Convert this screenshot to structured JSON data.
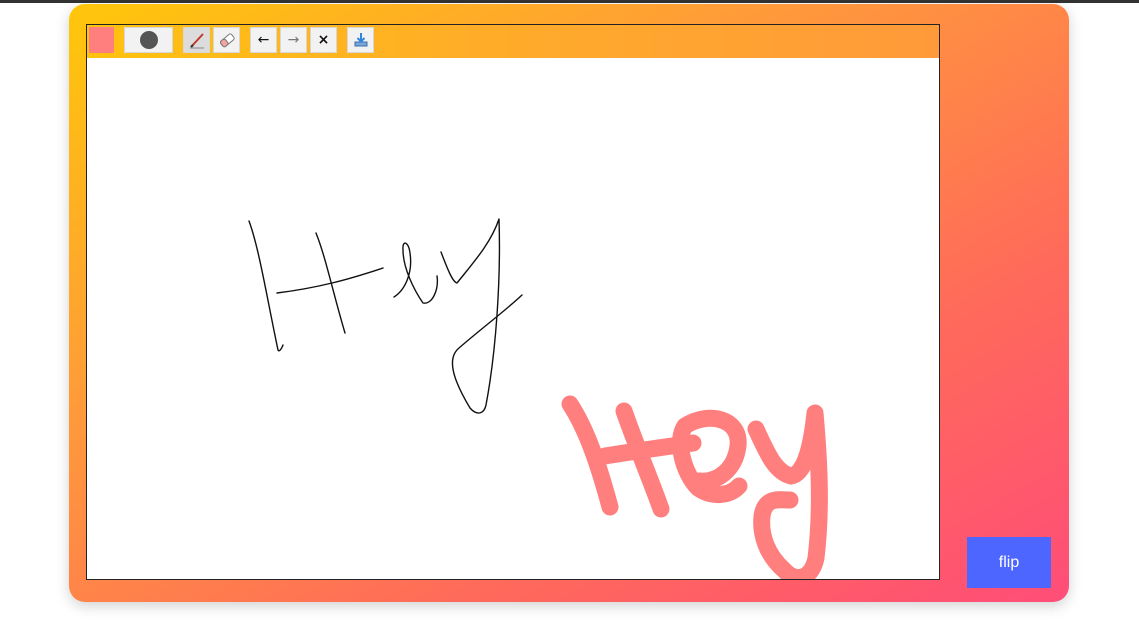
{
  "toolbar": {
    "color_swatch": "#ff7f7f",
    "size_icon": "brush-size-dot-icon",
    "pen_icon": "pen-icon",
    "eraser_icon": "eraser-icon",
    "undo_label": "←",
    "redo_label": "→",
    "clear_label": "×",
    "save_icon": "download-icon"
  },
  "canvas": {
    "stroke_colors": [
      "#111111",
      "#ff7f7f"
    ]
  },
  "flip_button": {
    "label": "flip"
  }
}
